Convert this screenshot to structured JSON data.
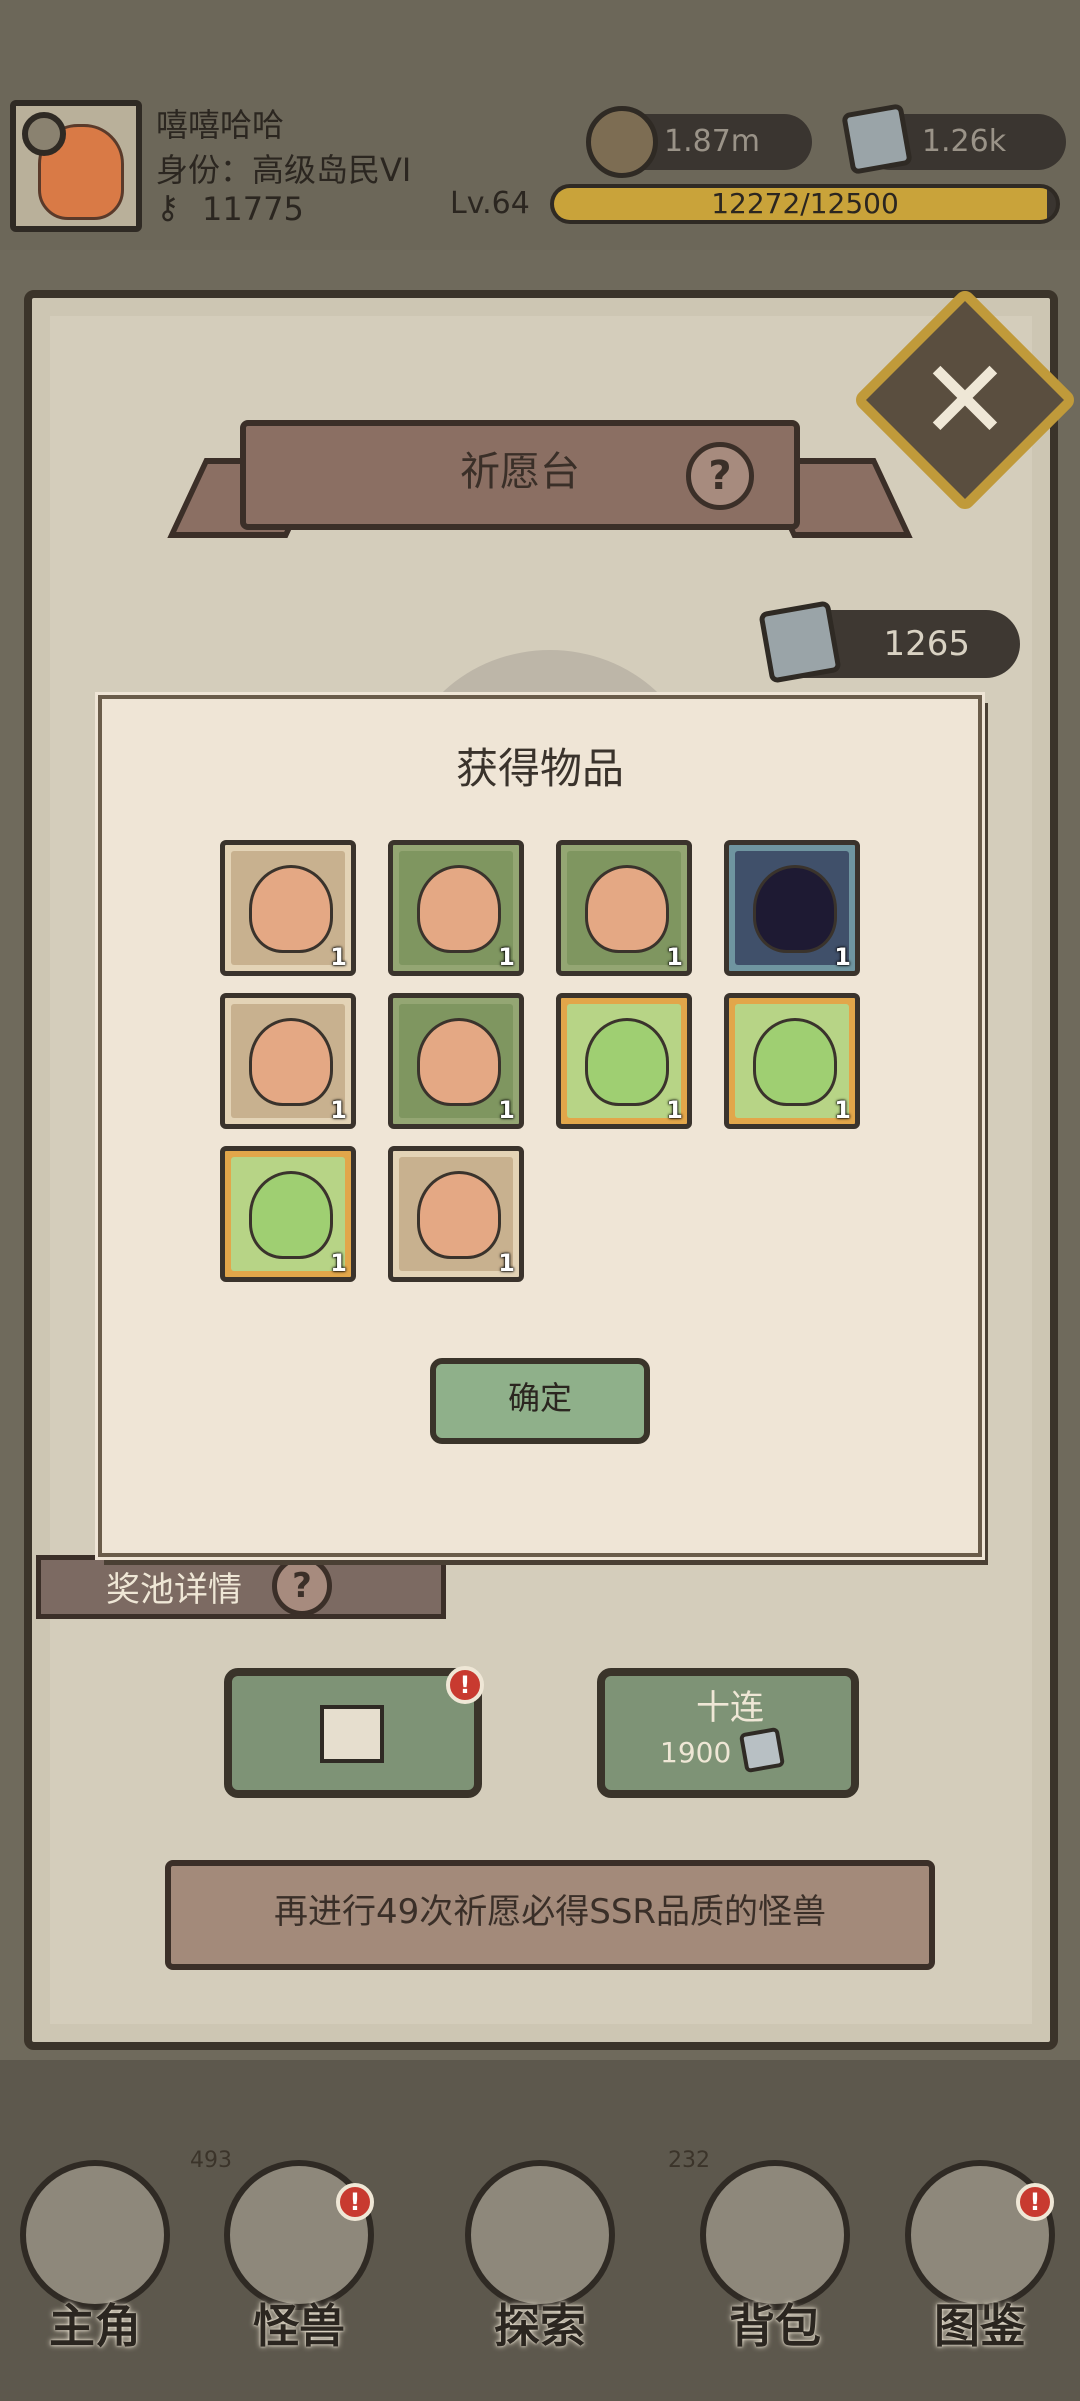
{
  "hud": {
    "player_name": "嘻嘻哈哈",
    "rank": "身份：高级岛民VI",
    "keys": "11775",
    "coins": "1.87m",
    "gems": "1.26k",
    "level": "Lv.64",
    "xp_text": "12272/12500",
    "xp_fraction": 0.982
  },
  "panel": {
    "title": "祈愿台",
    "help_symbol": "?",
    "gem_balance": "1265",
    "pool_label": "奖池详情",
    "single_button_badge": "!",
    "ten_label": "十连",
    "ten_cost": "1900",
    "guarantee_text": "再进行49次祈愿必得SSR品质的怪兽"
  },
  "dialog": {
    "title": "获得物品",
    "confirm_label": "确定",
    "items": [
      {
        "name": "axolotl-monster",
        "count": "1",
        "frame": "tan"
      },
      {
        "name": "mimic-jaws-monster",
        "count": "1",
        "frame": "green"
      },
      {
        "name": "pink-slime-monster",
        "count": "1",
        "frame": "green"
      },
      {
        "name": "dark-egg",
        "count": "1",
        "frame": "blue"
      },
      {
        "name": "chest-mimic-monster",
        "count": "1",
        "frame": "tan"
      },
      {
        "name": "plant-trap-monster",
        "count": "1",
        "frame": "green"
      },
      {
        "name": "green-slime-girl",
        "count": "1",
        "frame": "gold"
      },
      {
        "name": "bear-girl",
        "count": "1",
        "frame": "gold"
      },
      {
        "name": "green-hair-girl",
        "count": "1",
        "frame": "gold"
      },
      {
        "name": "fire-spirit",
        "count": "1",
        "frame": "tan"
      }
    ]
  },
  "nav": {
    "items": [
      {
        "label": "主角",
        "count": ""
      },
      {
        "label": "怪兽",
        "count": "493"
      },
      {
        "label": "探索",
        "count": ""
      },
      {
        "label": "背包",
        "count": "232"
      },
      {
        "label": "图鉴",
        "count": ""
      }
    ]
  },
  "colors": {
    "frame_tan": "#e3d3b6",
    "frame_green": "#94a673",
    "frame_blue": "#6f95a0",
    "frame_gold": "#e2a64a",
    "accent_red": "#c83a30"
  }
}
